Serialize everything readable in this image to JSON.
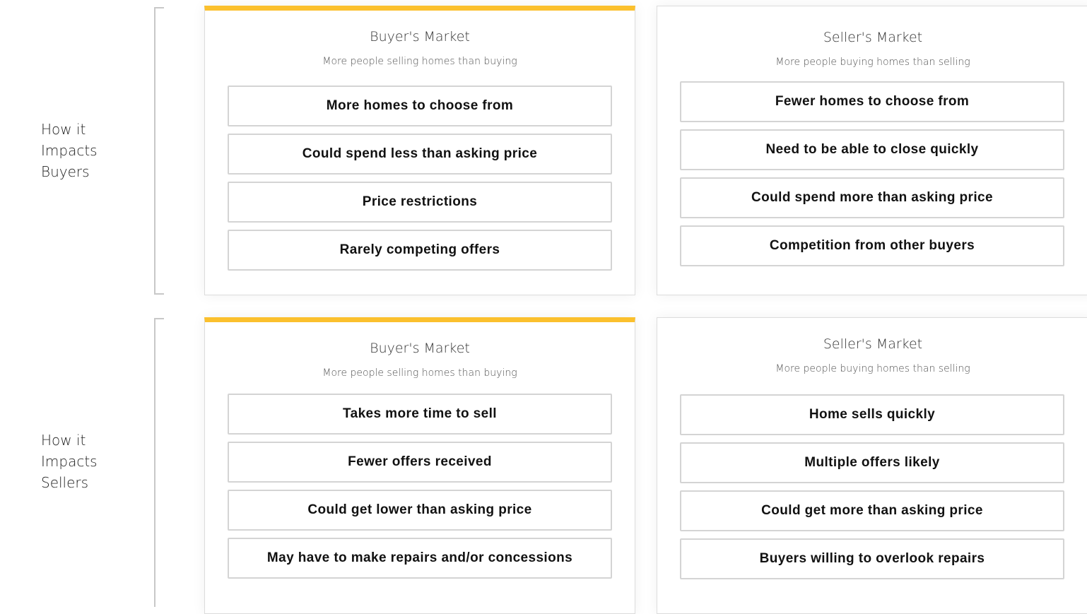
{
  "rows": [
    {
      "label": [
        "How it",
        "Impacts",
        "Buyers"
      ],
      "cards": [
        {
          "title": "Buyer's Market",
          "subtitle": "More people selling homes than buying",
          "items": [
            "More homes to choose from",
            "Could spend less than asking price",
            "Price restrictions",
            "Rarely competing offers"
          ]
        },
        {
          "title": "Seller's Market",
          "subtitle": "More people buying homes than selling",
          "items": [
            "Fewer homes to choose from",
            "Need to be able to close quickly",
            "Could spend more than asking price",
            "Competition from other buyers"
          ]
        }
      ]
    },
    {
      "label": [
        "How it",
        "Impacts",
        "Sellers"
      ],
      "cards": [
        {
          "title": "Buyer's Market",
          "subtitle": "More people selling homes than buying",
          "items": [
            "Takes more time to sell",
            "Fewer offers received",
            "Could get lower than asking price",
            "May have to make repairs and/or concessions"
          ]
        },
        {
          "title": "Seller's Market",
          "subtitle": "More people buying homes than selling",
          "items": [
            "Home sells quickly",
            "Multiple offers likely",
            "Could get more than asking price",
            "Buyers willing to overlook repairs"
          ]
        }
      ]
    }
  ],
  "colors": {
    "accent": "#fbc02d",
    "border": "#d4d4d4"
  }
}
